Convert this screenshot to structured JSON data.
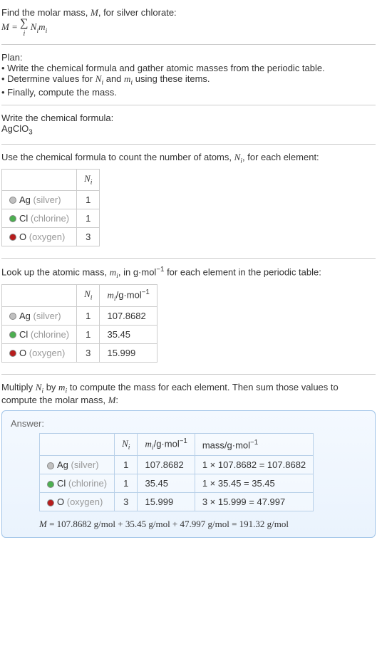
{
  "intro": {
    "line1": "Find the molar mass, ",
    "line1_var": "M",
    "line1_rest": ", for silver chlorate:",
    "formula_lhs": "M",
    "formula_eq": " = ",
    "formula_sum": "∑",
    "formula_sub": "i",
    "formula_rhs": " N",
    "formula_rhs_sub": "i",
    "formula_rhs2": "m",
    "formula_rhs2_sub": "i"
  },
  "plan": {
    "header": "Plan:",
    "b1": "• Write the chemical formula and gather atomic masses from the periodic table.",
    "b2_a": "• Determine values for ",
    "b2_n": "N",
    "b2_ni": "i",
    "b2_and": " and ",
    "b2_m": "m",
    "b2_mi": "i",
    "b2_rest": " using these items.",
    "b3": "• Finally, compute the mass."
  },
  "chemformula": {
    "header": "Write the chemical formula:",
    "ag": "AgClO",
    "sub": "3"
  },
  "count_atoms": {
    "text_a": "Use the chemical formula to count the number of atoms, ",
    "n": "N",
    "ni": "i",
    "text_b": ", for each element:",
    "header_n": "N",
    "header_ni": "i",
    "rows": [
      {
        "sym": "Ag",
        "name": "(silver)",
        "n": "1"
      },
      {
        "sym": "Cl",
        "name": "(chlorine)",
        "n": "1"
      },
      {
        "sym": "O",
        "name": "(oxygen)",
        "n": "3"
      }
    ]
  },
  "atomic_mass": {
    "text_a": "Look up the atomic mass, ",
    "m": "m",
    "mi": "i",
    "text_b": ", in g·mol",
    "exp": "−1",
    "text_c": " for each element in the periodic table:",
    "header_n": "N",
    "header_ni": "i",
    "header_m": "m",
    "header_mi": "i",
    "header_unit": "/g·mol",
    "header_exp": "−1",
    "rows": [
      {
        "sym": "Ag",
        "name": "(silver)",
        "n": "1",
        "m": "107.8682"
      },
      {
        "sym": "Cl",
        "name": "(chlorine)",
        "n": "1",
        "m": "35.45"
      },
      {
        "sym": "O",
        "name": "(oxygen)",
        "n": "3",
        "m": "15.999"
      }
    ]
  },
  "multiply": {
    "text_a": "Multiply ",
    "n": "N",
    "ni": "i",
    "text_b": " by ",
    "m": "m",
    "mi": "i",
    "text_c": " to compute the mass for each element. Then sum those values to compute the molar mass, ",
    "M": "M",
    "text_d": ":"
  },
  "answer": {
    "label": "Answer:",
    "header_n": "N",
    "header_ni": "i",
    "header_m": "m",
    "header_mi": "i",
    "header_unit": "/g·mol",
    "header_exp": "−1",
    "header_mass": "mass/g·mol",
    "header_mass_exp": "−1",
    "rows": [
      {
        "sym": "Ag",
        "name": "(silver)",
        "n": "1",
        "m": "107.8682",
        "mass": "1 × 107.8682 = 107.8682"
      },
      {
        "sym": "Cl",
        "name": "(chlorine)",
        "n": "1",
        "m": "35.45",
        "mass": "1 × 35.45 = 35.45"
      },
      {
        "sym": "O",
        "name": "(oxygen)",
        "n": "3",
        "m": "15.999",
        "mass": "3 × 15.999 = 47.997"
      }
    ],
    "final_M": "M",
    "final_eq": " = 107.8682 g/mol + 35.45 g/mol + 47.997 g/mol = 191.32 g/mol"
  }
}
